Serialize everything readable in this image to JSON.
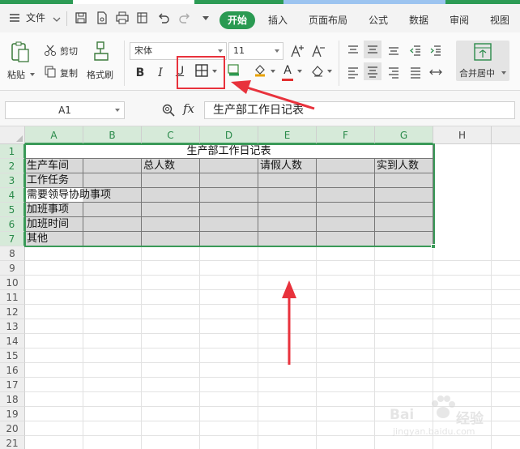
{
  "menubar": {
    "file_label": "文件",
    "tabs": [
      "开始",
      "插入",
      "页面布局",
      "公式",
      "数据",
      "审阅",
      "视图"
    ]
  },
  "ribbon": {
    "paste_label": "粘贴",
    "cut_label": "剪切",
    "copy_label": "复制",
    "format_painter_label": "格式刷",
    "font_name": "宋体",
    "font_size": "11",
    "bold": "B",
    "italic": "I",
    "underline": "U",
    "font_color_glyph": "A",
    "merge_center_label": "合并居中"
  },
  "formula_bar": {
    "cell_ref": "A1",
    "fx_label": "fx",
    "formula": "生产部工作日记表"
  },
  "columns": [
    "A",
    "B",
    "C",
    "D",
    "E",
    "F",
    "G",
    "H"
  ],
  "rows": [
    "1",
    "2",
    "3",
    "4",
    "5",
    "6",
    "7",
    "8",
    "9",
    "10",
    "11",
    "12",
    "13",
    "14",
    "15",
    "16",
    "17",
    "18",
    "19",
    "20",
    "21"
  ],
  "sheet": {
    "title": "生产部工作日记表",
    "row2": {
      "a": "生产车间",
      "c": "总人数",
      "e": "请假人数",
      "g": "实到人数"
    },
    "row3": "工作任务",
    "row4": "需要领导协助事项",
    "row5": "加班事项",
    "row6": "加班时间",
    "row7": "其他"
  },
  "watermark": {
    "brand": "Bai",
    "brand2": "经验",
    "sub": "jingyan.baidu.com"
  },
  "colors": {
    "accent": "#2a9a52",
    "annotation": "#e8323c",
    "header_fill": "#d9d9d9"
  }
}
